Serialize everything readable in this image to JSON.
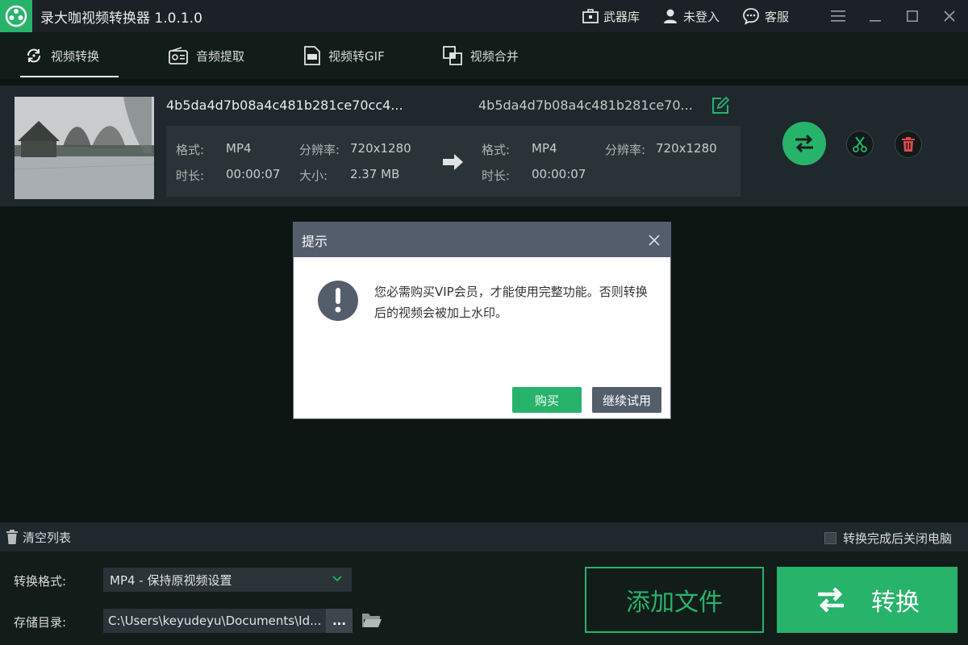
{
  "titlebar": {
    "app_title": "录大咖视频转换器  1.0.1.0",
    "arsenal": "武器库",
    "login": "未登入",
    "service": "客服"
  },
  "tabs": [
    {
      "label": "视频转换",
      "icon": "rotate-icon",
      "active": true
    },
    {
      "label": "音频提取",
      "icon": "radio-icon",
      "active": false
    },
    {
      "label": "视频转GIF",
      "icon": "gif-file-icon",
      "active": false
    },
    {
      "label": "视频合并",
      "icon": "merge-icon",
      "active": false
    }
  ],
  "file": {
    "source_name": "4b5da4d7b08a4c481b281ce70cc4...",
    "output_name": "4b5da4d7b08a4c481b281ce70...",
    "source": {
      "format_label": "格式:",
      "format": "MP4",
      "resolution_label": "分辨率:",
      "resolution": "720x1280",
      "duration_label": "时长:",
      "duration": "00:00:07",
      "size_label": "大小:",
      "size": "2.37 MB"
    },
    "output": {
      "format_label": "格式:",
      "format": "MP4",
      "resolution_label": "分辨率:",
      "resolution": "720x1280",
      "duration_label": "时长:",
      "duration": "00:00:07"
    }
  },
  "dialog": {
    "title": "提示",
    "message": "您必需购买VIP会员，才能使用完整功能。否则转换后的视频会被加上水印。",
    "buy": "购买",
    "continue_trial": "继续试用"
  },
  "list_bar": {
    "clear": "清空列表",
    "shutdown": "转换完成后关闭电脑"
  },
  "bottom": {
    "format_label": "转换格式:",
    "format_value": "MP4 - 保持原视频设置",
    "dir_label": "存储目录:",
    "dir_value": "C:\\Users\\keyudeyu\\Documents\\Id...",
    "browse": "...",
    "add_file": "添加文件",
    "convert": "转换"
  },
  "colors": {
    "accent": "#27b36a",
    "danger": "#e04848",
    "dialog_header": "#535d6b"
  }
}
